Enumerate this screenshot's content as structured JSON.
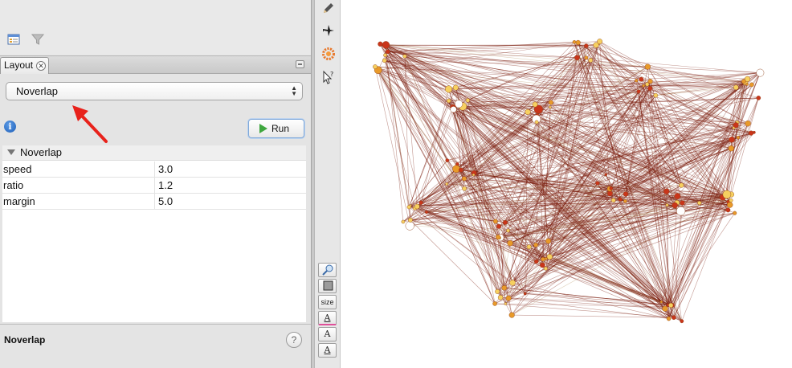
{
  "layout_panel": {
    "tab_label": "Layout",
    "close_icon": "close-icon",
    "minimize_icon": "minimize-icon",
    "selected_layout": "Noverlap",
    "info_icon": "info-icon",
    "run_label": "Run",
    "properties": {
      "group_title": "Noverlap",
      "rows": [
        {
          "name": "speed",
          "value": "3.0"
        },
        {
          "name": "ratio",
          "value": "1.2"
        },
        {
          "name": "margin",
          "value": "5.0"
        }
      ]
    },
    "description_title": "Noverlap",
    "help_label": "?"
  },
  "top_toolbar": {
    "icons": [
      "table-icon",
      "filter-icon"
    ]
  },
  "side_toolbar": {
    "top_icons": [
      "pencil-icon",
      "airplane-icon",
      "settings-icon",
      "select-help-icon"
    ],
    "bottom_buttons": [
      {
        "icon": "zoom-icon",
        "label": ""
      },
      {
        "icon": "square-node-icon",
        "label": ""
      },
      {
        "icon": "size-icon",
        "label": "size"
      },
      {
        "icon": "label-color-icon",
        "label": "A"
      },
      {
        "icon": "label-size-icon",
        "label": "A"
      },
      {
        "icon": "label-font-icon",
        "label": "A"
      }
    ]
  },
  "graph": {
    "type": "network",
    "edge_color": "#7a1a0c",
    "node_colors": [
      "#f6d060",
      "#e89a2a",
      "#c9351a",
      "#ffffff"
    ]
  },
  "annotation": {
    "color": "#e8221b"
  }
}
